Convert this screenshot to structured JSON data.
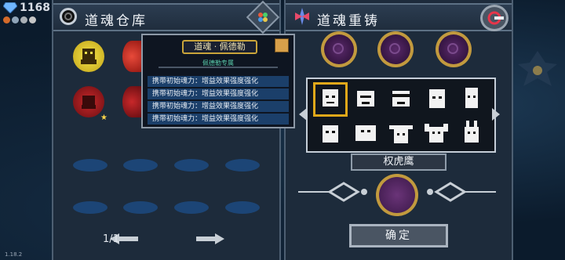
{
  "hud": {
    "gem_count": "1168",
    "version": "1.18.2"
  },
  "left_panel": {
    "title": "道魂仓库",
    "page": "1/1"
  },
  "right_panel": {
    "title": "道魂重铸",
    "selected_name": "权虎鹰",
    "confirm_label": "确定"
  },
  "tooltip": {
    "title": "道魂 · 佩德勒",
    "subtitle": "佩德勒专属",
    "effects": [
      "携带初始魂力：增益效果强度强化",
      "携带初始魂力：增益效果强度强化",
      "携带初始魂力：增益效果强度强化",
      "携带初始魂力：增益效果强度强化"
    ]
  },
  "colors": {
    "accent_gold": "#c29a3e",
    "slot_blue": "#1c4576",
    "selection": "#e0a81a",
    "effect_row": "#1b3f6a"
  },
  "icons": {
    "gem": "blue-gem-icon",
    "header_left": "ring-icon",
    "header_right": "soul-sword-icon",
    "filter": "filter-diamond-icon",
    "exit": "exit-icon"
  }
}
